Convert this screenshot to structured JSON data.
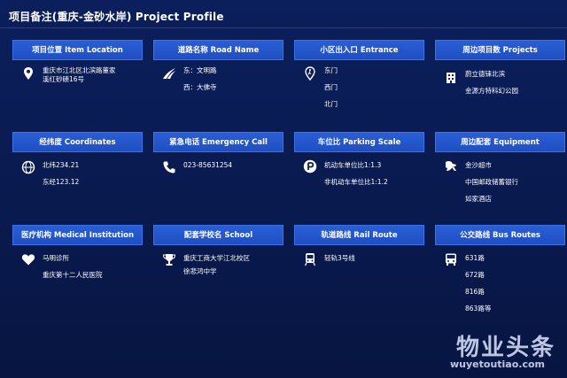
{
  "header": {
    "title": "项目备注(重庆-金砂水岸)   Project Profile"
  },
  "cards": {
    "location": {
      "header": "项目位置   Item Location",
      "lines": [
        "重庆市江北区北滨路董家",
        "溪红砂碛16号"
      ]
    },
    "road": {
      "header": "道路名称   Road Name",
      "lines": [
        "东：文明路",
        "西：大佛寺"
      ]
    },
    "entrance": {
      "header": "小区出入口   Entrance",
      "lines": [
        "东门",
        "西门",
        "北门"
      ]
    },
    "projects": {
      "header": "周边项目数   Projects",
      "lines": [
        "蔚立德铼北滨",
        "金源方特科幻公园"
      ]
    },
    "coordinates": {
      "header": "经纬度   Coordinates",
      "lines": [
        "北纬234.21",
        "东经123.12"
      ]
    },
    "emergency": {
      "header": "紧急电话   Emergency Call",
      "lines": [
        "023-85631254"
      ]
    },
    "parking": {
      "header": "车位比   Parking Scale",
      "lines": [
        "机动车单位比1:1.3",
        "非机动车单位比1:1.2"
      ]
    },
    "equipment": {
      "header": "周边配套   Equipment",
      "lines": [
        "金沙超市",
        "中国邮政储蓄银行",
        "如家酒店"
      ]
    },
    "medical": {
      "header": "医疗机构   Medical Institution",
      "lines": [
        "马明诊所",
        "重庆第十二人民医院"
      ]
    },
    "school": {
      "header": "配套学校名   School",
      "lines": [
        "重庆工商大学江北校区",
        "徐悲鸿中学"
      ]
    },
    "rail": {
      "header": "轨道路线   Rail Route",
      "lines": [
        "轻轨3号线"
      ]
    },
    "bus": {
      "header": "公交路线   Bus Routes",
      "lines": [
        "631路",
        "672路",
        "816路",
        "863路等"
      ]
    }
  },
  "icons": {
    "location": "location-pin-icon",
    "road": "road-icon",
    "entrance": "entrance-pin-icon",
    "projects": "building-icon",
    "coordinates": "globe-icon",
    "emergency": "phone-icon",
    "parking": "parking-icon",
    "equipment": "store-icon",
    "medical": "heart-icon",
    "school": "trophy-icon",
    "rail": "train-icon",
    "bus": "bus-icon"
  },
  "watermark": {
    "brand": "物业头条",
    "url": "wuyetoutiao.com"
  },
  "colors": {
    "background": "#0b1f5c",
    "header_bar": "#2a5ed6",
    "text": "#ffffff"
  }
}
